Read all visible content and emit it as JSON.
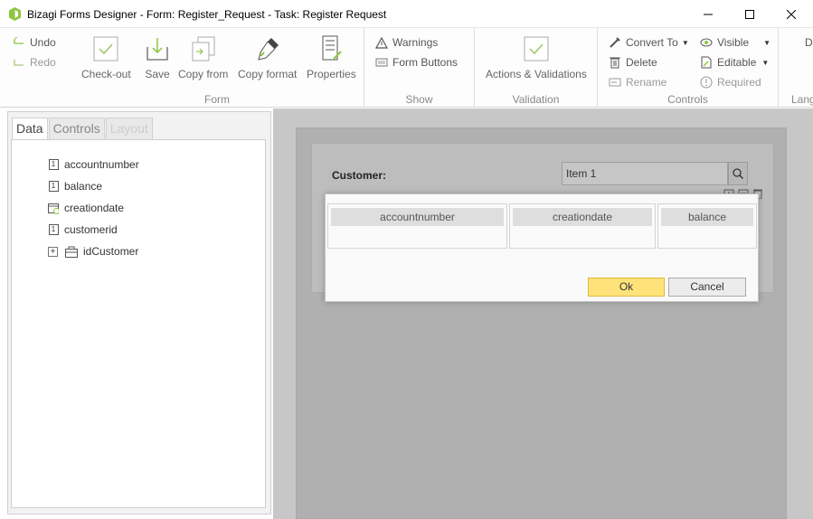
{
  "window": {
    "title": "Bizagi Forms Designer  - Form: Register_Request - Task:  Register Request"
  },
  "ribbon": {
    "undo": "Undo",
    "redo": "Redo",
    "form_group": {
      "label": "Form",
      "checkout": "Check-out",
      "save": "Save",
      "copy_from": "Copy from",
      "copy_format": "Copy format",
      "properties": "Properties"
    },
    "show_group": {
      "label": "Show",
      "warnings": "Warnings",
      "form_buttons": "Form Buttons"
    },
    "validation_group": {
      "label": "Validation",
      "actions": "Actions & Validations"
    },
    "controls_group": {
      "label": "Controls",
      "convert_to": "Convert To",
      "delete": "Delete",
      "rename": "Rename",
      "visible": "Visible",
      "editable": "Editable",
      "required": "Required"
    },
    "lang_group": {
      "label": "Lang",
      "btn": "D"
    }
  },
  "left_panel": {
    "tabs": [
      "Data",
      "Controls",
      "Layout"
    ],
    "tree": [
      {
        "label": "accountnumber",
        "icon": "number"
      },
      {
        "label": "balance",
        "icon": "number"
      },
      {
        "label": "creationdate",
        "icon": "date"
      },
      {
        "label": "customerid",
        "icon": "number"
      },
      {
        "label": "idCustomer",
        "icon": "entity"
      }
    ]
  },
  "form": {
    "customer_label": "Customer:",
    "customer_value": "Item 1"
  },
  "dialog": {
    "columns": [
      "accountnumber",
      "creationdate",
      "balance"
    ],
    "ok": "Ok",
    "cancel": "Cancel"
  },
  "colors": {
    "accent_green": "#8dc63f",
    "ok_yellow": "#ffe37a",
    "canvas_gray": "#c7c7c7"
  }
}
